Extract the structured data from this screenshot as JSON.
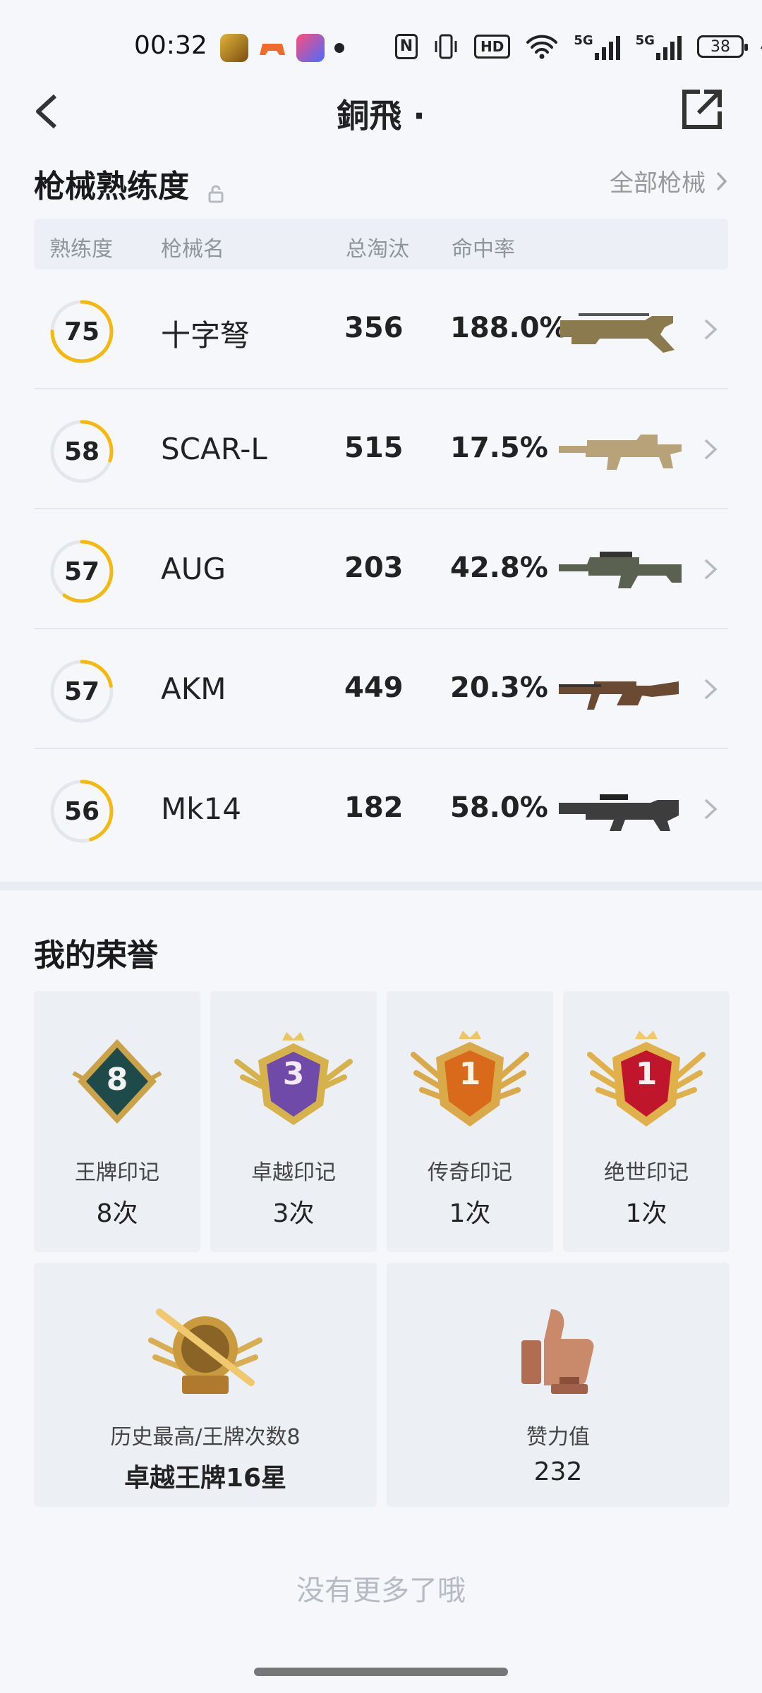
{
  "status_bar": {
    "time": "00:32",
    "battery": "38",
    "network1": "5G",
    "network2": "5G",
    "hd_label": "HD",
    "nfc_label": "N"
  },
  "header": {
    "title": "銅飛 ·"
  },
  "weapon_section": {
    "title": "枪械熟练度",
    "all_link": "全部枪械",
    "columns": [
      "熟练度",
      "枪械名",
      "总淘汰",
      "命中率"
    ],
    "rows": [
      {
        "mastery": "75",
        "mastery_pct": 0.75,
        "name": "十字弩",
        "kills": "356",
        "hit_rate": "188.0%"
      },
      {
        "mastery": "58",
        "mastery_pct": 0.3,
        "name": "SCAR-L",
        "kills": "515",
        "hit_rate": "17.5%"
      },
      {
        "mastery": "57",
        "mastery_pct": 0.6,
        "name": "AUG",
        "kills": "203",
        "hit_rate": "42.8%"
      },
      {
        "mastery": "57",
        "mastery_pct": 0.22,
        "name": "AKM",
        "kills": "449",
        "hit_rate": "20.3%"
      },
      {
        "mastery": "56",
        "mastery_pct": 0.45,
        "name": "Mk14",
        "kills": "182",
        "hit_rate": "58.0%"
      }
    ]
  },
  "honor_section": {
    "title": "我的荣誉",
    "medals": [
      {
        "badge_number": "8",
        "label": "王牌印记",
        "count": "8次",
        "icon": "ace-emblem-icon"
      },
      {
        "badge_number": "3",
        "label": "卓越印记",
        "count": "3次",
        "icon": "excellence-emblem-icon"
      },
      {
        "badge_number": "1",
        "label": "传奇印记",
        "count": "1次",
        "icon": "legend-emblem-icon"
      },
      {
        "badge_number": "1",
        "label": "绝世印记",
        "count": "1次",
        "icon": "peerless-emblem-icon"
      }
    ],
    "highest": {
      "label": "历史最高/王牌次数8",
      "value": "卓越王牌16星",
      "icon": "sniper-rank-badge-icon"
    },
    "likes": {
      "label": "赞力值",
      "value": "232",
      "icon": "thumbs-up-trophy-icon"
    }
  },
  "footer": {
    "no_more": "没有更多了哦"
  },
  "colors": {
    "accent": "#f5b80c",
    "background": "#f5f7fb",
    "card": "#eceff4"
  }
}
